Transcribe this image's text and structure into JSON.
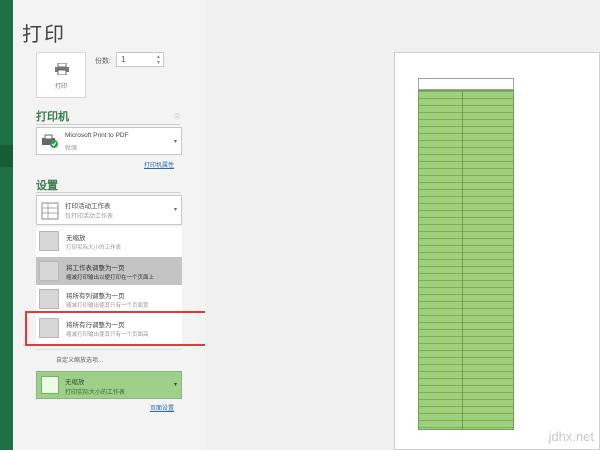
{
  "title": "打印",
  "print_button": {
    "label": "打印"
  },
  "copies": {
    "label": "份数:",
    "value": "1"
  },
  "printer_section": {
    "heading": "打印机",
    "printer_name": "Microsoft Print to PDF",
    "printer_status": "就绪",
    "properties_link": "打印机属性"
  },
  "settings_section": {
    "heading": "设置",
    "what_to_print": {
      "title": "打印活动工作表",
      "subtitle": "仅打印活动工作表"
    },
    "options": [
      {
        "title": "无缩放",
        "subtitle": "打印实际大小的工作表"
      },
      {
        "title": "将工作表调整为一页",
        "subtitle": "缩减打印输出以便打印在一个页面上"
      },
      {
        "title": "将所有列调整为一页",
        "subtitle": "缩减打印输出使其只有一个页面宽"
      },
      {
        "title": "将所有行调整为一页",
        "subtitle": "缩减打印输出使其只有一个页面高"
      }
    ],
    "custom_options_link": "自定义缩放选项...",
    "scaling_current": {
      "title": "无缩放",
      "subtitle": "打印实际大小的工作表"
    },
    "page_setup_link": "页面设置"
  },
  "watermark": "jdhx.net",
  "colors": {
    "accent": "#1e7145",
    "highlight": "#e53935",
    "sheet_fill": "#9fd07b"
  }
}
